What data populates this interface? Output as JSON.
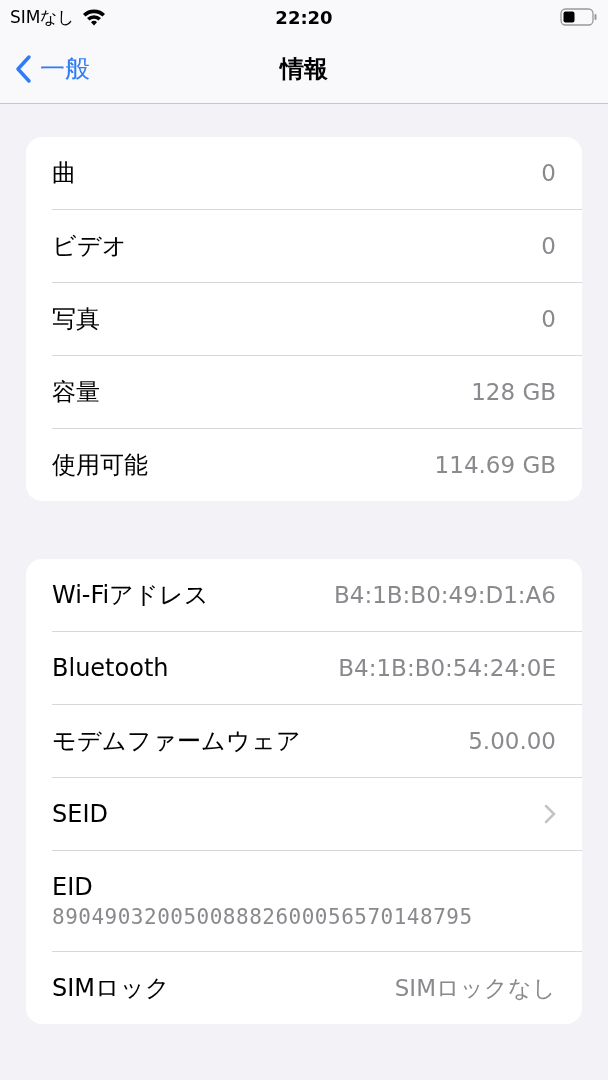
{
  "status_bar": {
    "carrier": "SIMなし",
    "time": "22:20"
  },
  "nav": {
    "back": "一般",
    "title": "情報"
  },
  "sections": [
    {
      "rows": [
        {
          "kind": "value",
          "label": "曲",
          "value": "0"
        },
        {
          "kind": "value",
          "label": "ビデオ",
          "value": "0"
        },
        {
          "kind": "value",
          "label": "写真",
          "value": "0"
        },
        {
          "kind": "value",
          "label": "容量",
          "value": "128 GB"
        },
        {
          "kind": "value",
          "label": "使用可能",
          "value": "114.69 GB"
        }
      ]
    },
    {
      "rows": [
        {
          "kind": "value",
          "label": "Wi-Fiアドレス",
          "value": "B4:1B:B0:49:D1:A6"
        },
        {
          "kind": "value",
          "label": "Bluetooth",
          "value": "B4:1B:B0:54:24:0E"
        },
        {
          "kind": "value",
          "label": "モデムファームウェア",
          "value": "5.00.00"
        },
        {
          "kind": "chevron",
          "label": "SEID"
        },
        {
          "kind": "stacked",
          "label": "EID",
          "value": "89049032005008882600056570148795"
        },
        {
          "kind": "value",
          "label": "SIMロック",
          "value": "SIMロックなし"
        }
      ]
    }
  ]
}
